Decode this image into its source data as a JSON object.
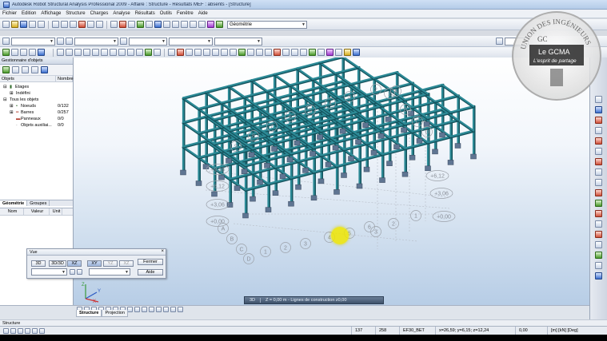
{
  "window": {
    "title": "Autodesk Robot Structural Analysis Professional 2009 - Affaire : Structure - Résultats MEF : absents - [Structure]"
  },
  "menu": [
    "Fichier",
    "Edition",
    "Affichage",
    "Structure",
    "Charges",
    "Analyse",
    "Résultats",
    "Outils",
    "Fenêtre",
    "Aide"
  ],
  "toolbar": {
    "layout_combo": "Géométrie"
  },
  "object_manager": {
    "title": "Gestionnaire d'objets",
    "col_objets": "Objets",
    "col_nombre": "Nombre",
    "tree": [
      {
        "label": "Etages",
        "value": ""
      },
      {
        "label": "Indéfini",
        "value": ""
      },
      {
        "label": "Tous les objets",
        "value": ""
      },
      {
        "label": "Noeuds",
        "value": "0/132"
      },
      {
        "label": "Barres",
        "value": "0/257"
      },
      {
        "label": "Panneaux",
        "value": "0/0"
      },
      {
        "label": "Objets auxiliai...",
        "value": "0/0"
      }
    ],
    "tab_geometrie": "Géométrie",
    "tab_groupes": "Groupes",
    "props_nom": "Nom",
    "props_valeur": "Valeur",
    "props_unit": "Unit"
  },
  "vue_dialog": {
    "title": "Vue",
    "btn_3d": "3D",
    "btn_3d2": "3D/3D",
    "btn_xz": "XZ",
    "btn_xy": "XY",
    "btn_yz": "YZ",
    "btn_xz2": "XZ",
    "fermer": "Fermer",
    "aide": "Aide"
  },
  "viewport": {
    "level_labels": [
      "+9,18",
      "+6,12",
      "+3,06",
      "+0,00"
    ],
    "level_labels_right": [
      "+6,12",
      "+3,06",
      "+0,00"
    ],
    "axis_letters": [
      "A",
      "B",
      "C",
      "D"
    ],
    "axis_numbers_left": [
      "9",
      "8",
      "7",
      "6",
      "5",
      "4",
      "3",
      "2",
      "1"
    ],
    "axis_numbers_right": [
      "3",
      "2",
      "1"
    ],
    "axis_x": "X",
    "axis_y": "Y",
    "axis_z": "Z",
    "zbar_3d": "3D",
    "zbar_text": "Z = 0,00 m - Lignes de construction z0,00"
  },
  "view_tabs": {
    "structure": "Structure",
    "projection": "Projection"
  },
  "status": {
    "line": "Structure",
    "n1": "137",
    "n2": "258",
    "section": "EF30_BET",
    "coords": "x=26,59; y=6,15; z=12,24",
    "zero": "0,00",
    "units": "[m] [kN] [Deg]"
  },
  "watermark": {
    "ring_text": "UNION DES INGÉNIEURS",
    "brand": "Le GCMA",
    "tagline": "L'esprit de partage",
    "mono": "GC"
  },
  "colors": {
    "structure": "#2c8a96",
    "structure_dark": "#14525c",
    "support": "#5f7592",
    "cursor": "#f0e600"
  }
}
